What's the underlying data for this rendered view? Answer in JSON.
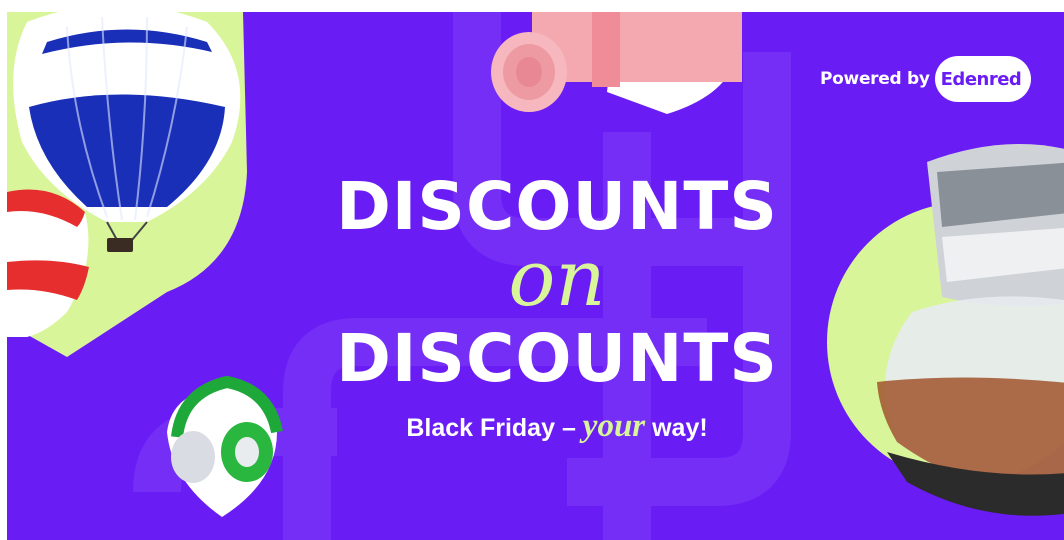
{
  "banner": {
    "brand_prefix": "Powered by",
    "brand_name": "Edenred",
    "headline_line1": "DISCOUNTS",
    "headline_line2": "on",
    "headline_line3": "DISCOUNTS",
    "tagline_before": "Black Friday –",
    "tagline_emphasis": "your",
    "tagline_after": "way!"
  },
  "colors": {
    "background": "#6a1cf5",
    "accent_lime": "#d9f59a",
    "text": "#ffffff"
  },
  "icons": [
    "hot-air-balloon-icon",
    "yoga-mat-icon",
    "headphones-icon",
    "coffee-maker-icon"
  ]
}
